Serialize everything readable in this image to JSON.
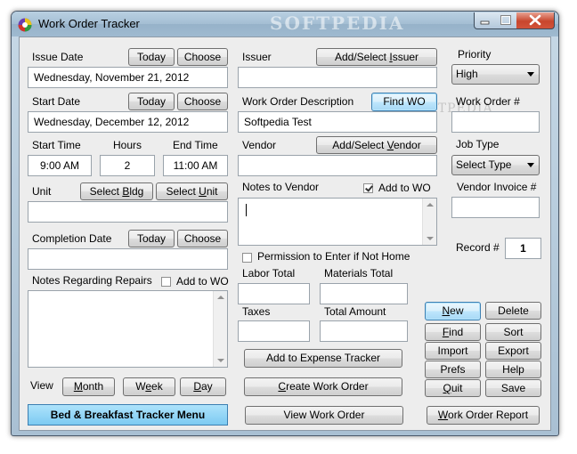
{
  "window": {
    "title": "Work Order Tracker",
    "watermark": "SOFTPEDIA"
  },
  "issue_date": {
    "label": "Issue Date",
    "today": "Today",
    "choose": "Choose",
    "value": "Wednesday, November 21, 2012"
  },
  "start_date": {
    "label": "Start Date",
    "today": "Today",
    "choose": "Choose",
    "value": "Wednesday, December 12, 2012"
  },
  "time": {
    "start_label": "Start Time",
    "start_value": "9:00 AM",
    "hours_label": "Hours",
    "hours_value": "2",
    "end_label": "End Time",
    "end_value": "11:00 AM"
  },
  "unit": {
    "label": "Unit",
    "select_bldg": "Select Bldg",
    "select_unit": "Select Unit",
    "value": ""
  },
  "completion": {
    "label": "Completion Date",
    "today": "Today",
    "choose": "Choose",
    "value": ""
  },
  "repairs": {
    "label": "Notes Regarding Repairs",
    "add_to_wo": "Add to WO",
    "add_checked": false
  },
  "view": {
    "label": "View",
    "month": "Month",
    "week": "Week",
    "day": "Day"
  },
  "menu_button": "Bed & Breakfast Tracker Menu",
  "issuer": {
    "label": "Issuer",
    "button": "Add/Select Issuer",
    "value": ""
  },
  "description": {
    "label": "Work Order Description",
    "find": "Find WO",
    "value": "Softpedia Test"
  },
  "vendor": {
    "label": "Vendor",
    "button": "Add/Select Vendor",
    "value": ""
  },
  "notes_vendor": {
    "label": "Notes to Vendor",
    "add_to_wo": "Add to WO",
    "add_checked": true
  },
  "permission": {
    "label": "Permission to Enter if Not Home",
    "checked": false
  },
  "totals": {
    "labor": "Labor Total",
    "materials": "Materials Total",
    "taxes": "Taxes",
    "amount": "Total Amount"
  },
  "actions": {
    "expense": "Add to Expense Tracker",
    "create": "Create Work Order",
    "view": "View Work Order",
    "report": "Work Order Report"
  },
  "priority": {
    "label": "Priority",
    "value": "High"
  },
  "work_order_num": {
    "label": "Work Order #",
    "value": ""
  },
  "job_type": {
    "label": "Job Type",
    "value": "Select Type"
  },
  "vendor_invoice": {
    "label": "Vendor Invoice #",
    "value": ""
  },
  "record": {
    "label": "Record #",
    "value": "1"
  },
  "nav": {
    "new": "New",
    "delete": "Delete",
    "find": "Find",
    "sort": "Sort",
    "import": "Import",
    "export": "Export",
    "prefs": "Prefs",
    "help": "Help",
    "quit": "Quit",
    "save": "Save"
  },
  "colors": {
    "menu_button": "#7ccaf2",
    "close_button": "#c8462d"
  },
  "icons": {
    "app": "app-logo-icon",
    "minimize": "minimize-icon",
    "maximize": "maximize-icon",
    "close": "close-icon"
  }
}
